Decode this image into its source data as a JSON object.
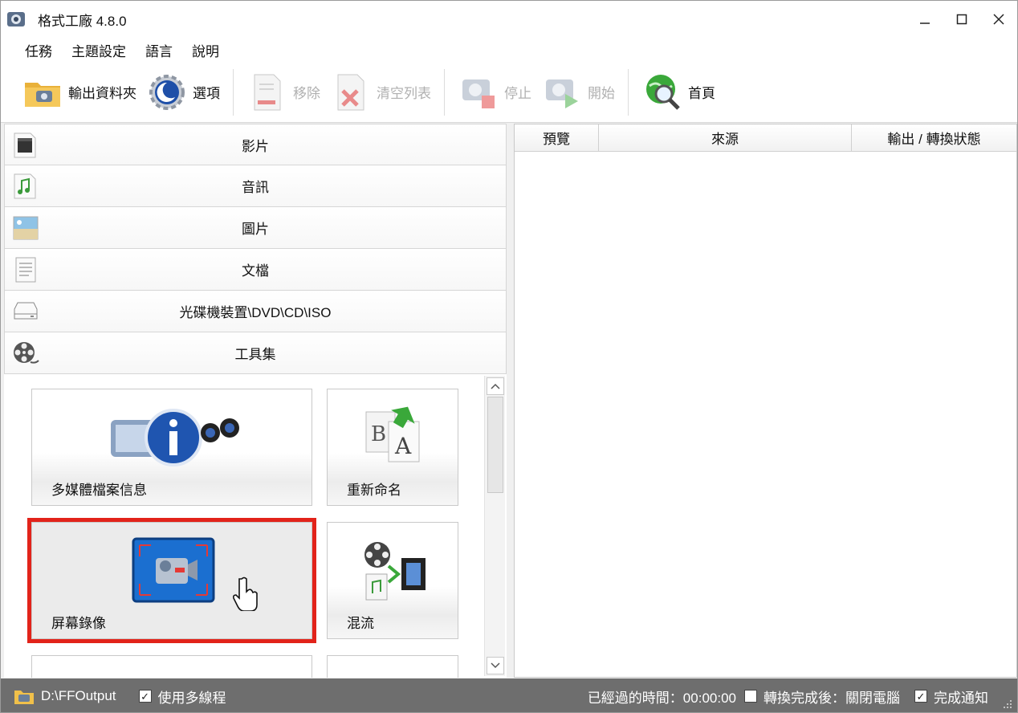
{
  "window": {
    "title": "格式工廠 4.8.0",
    "controls": {
      "minimize": "–",
      "maximize": "☐",
      "close": "✕"
    }
  },
  "menu": [
    "任務",
    "主題設定",
    "語言",
    "說明"
  ],
  "toolbar": {
    "output_folder": "輸出資料夾",
    "options": "選項",
    "remove": "移除",
    "clear_list": "清空列表",
    "stop": "停止",
    "start": "開始",
    "home": "首頁"
  },
  "categories": [
    "影片",
    "音訊",
    "圖片",
    "文檔",
    "光碟機裝置\\DVD\\CD\\ISO",
    "工具集"
  ],
  "tools": [
    {
      "label": "多媒體檔案信息",
      "icon": "media-info-icon"
    },
    {
      "label": "重新命名",
      "icon": "rename-icon"
    },
    {
      "label": "屏幕錄像",
      "icon": "screen-record-icon",
      "selected": true
    },
    {
      "label": "混流",
      "icon": "mux-icon"
    }
  ],
  "list_columns": [
    "預覽",
    "來源",
    "輸出 / 轉換狀態"
  ],
  "status": {
    "output_path": "D:\\FFOutput",
    "multithread_label": "使用多線程",
    "multithread_checked": true,
    "elapsed": "已經過的時間：00:00:00",
    "shutdown_label": "轉換完成後：關閉電腦",
    "shutdown_checked": false,
    "notify_label": "完成通知",
    "notify_checked": true
  },
  "colors": {
    "selection_outline": "#e2231a",
    "statusbar": "#6e6e6e"
  }
}
